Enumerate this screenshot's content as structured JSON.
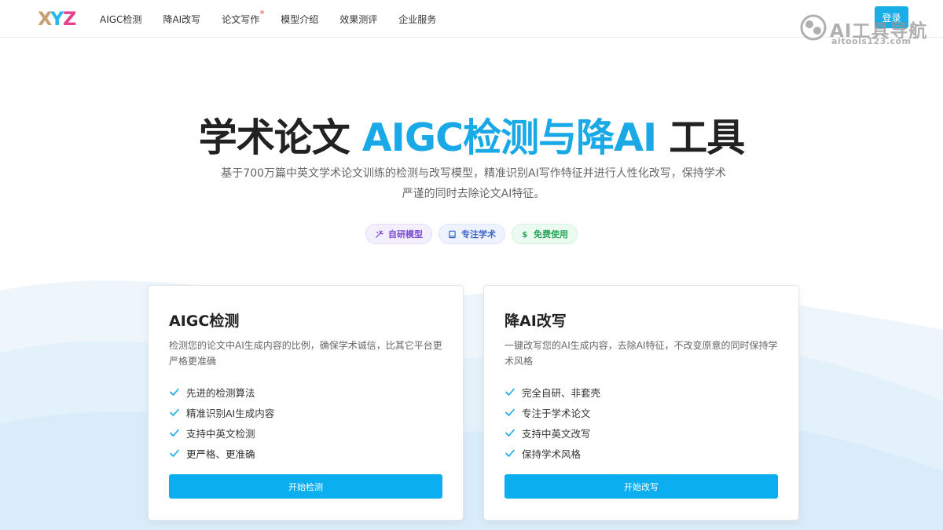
{
  "header": {
    "logo_text": "XYZ",
    "nav": [
      {
        "label": "AIGC检测"
      },
      {
        "label": "降AI改写"
      },
      {
        "label": "论文写作",
        "has_dot": true
      },
      {
        "label": "模型介绍"
      },
      {
        "label": "效果测评"
      },
      {
        "label": "企业服务"
      }
    ],
    "login_label": "登录"
  },
  "watermark": {
    "title": "AI工具导航",
    "subtitle": "aitools123.com"
  },
  "hero": {
    "title_prefix": "学术论文 ",
    "title_accent": "AIGC检测与降AI",
    "title_suffix": " 工具",
    "description": "基于700万篇中英文学术论文训练的检测与改写模型，精准识别AI写作特征并进行人性化改写，保持学术严谨的同时去除论文AI特征。",
    "badges": [
      {
        "label": "自研模型",
        "icon": "sparkle-icon",
        "color": "#7b4fd6"
      },
      {
        "label": "专注学术",
        "icon": "book-icon",
        "color": "#3e66c8"
      },
      {
        "label": "免费使用",
        "icon": "dollar-icon",
        "color": "#2aa55a"
      }
    ]
  },
  "cards": [
    {
      "title": "AIGC检测",
      "description": "检测您的论文中AI生成内容的比例，确保学术诚信，比其它平台更严格更准确",
      "features": [
        "先进的检测算法",
        "精准识别AI生成内容",
        "支持中英文检测",
        "更严格、更准确"
      ],
      "button_label": "开始检测"
    },
    {
      "title": "降AI改写",
      "description": "一键改写您的AI生成内容，去除AI特征，不改变原意的同时保持学术风格",
      "features": [
        "完全自研、非套壳",
        "专注于学术论文",
        "支持中英文改写",
        "保持学术风格"
      ],
      "button_label": "开始改写"
    }
  ],
  "colors": {
    "accent": "#18a9e6",
    "button": "#0baeef",
    "check": "#18a9e6"
  }
}
